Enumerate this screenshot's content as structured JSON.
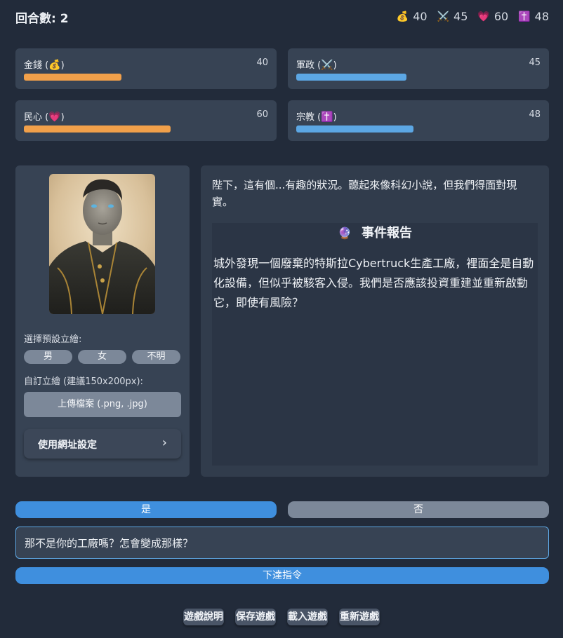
{
  "header": {
    "round_label": "回合數: 2",
    "stats": [
      {
        "icon": "money-bag-icon",
        "glyph": "💰",
        "value": "40"
      },
      {
        "icon": "crossed-swords-icon",
        "glyph": "⚔️",
        "value": "45"
      },
      {
        "icon": "heart-icon",
        "glyph": "💗",
        "value": "60"
      },
      {
        "icon": "latin-cross-icon",
        "glyph": "✝️",
        "value": "48"
      }
    ]
  },
  "stats": {
    "money": {
      "label_prefix": "金錢 (",
      "glyph": "💰",
      "label_suffix": ")",
      "value": "40",
      "level_percent": 40,
      "color": "#f1a04a"
    },
    "military": {
      "label_prefix": "軍政 (",
      "glyph": "⚔️",
      "label_suffix": ")",
      "value": "45",
      "level_percent": 45,
      "color": "#5ca7e4"
    },
    "people": {
      "label_prefix": "民心 (",
      "glyph": "💗",
      "label_suffix": ")",
      "value": "60",
      "level_percent": 60,
      "color": "#f1a04a"
    },
    "religion": {
      "label_prefix": "宗教 (",
      "glyph": "✝️",
      "label_suffix": ")",
      "value": "48",
      "level_percent": 48,
      "color": "#5ca7e4"
    }
  },
  "portrait_panel": {
    "preset_label": "選擇預設立繪:",
    "presets": [
      "男",
      "女",
      "不明"
    ],
    "custom_label": "自訂立繪 (建議150x200px):",
    "upload_label": "上傳檔案 (.png, .jpg)",
    "url_label": "使用網址設定",
    "url_chevron": "›"
  },
  "event": {
    "advisor_text": "陛下，這有個...有趣的狀況。聽起來像科幻小說，但我們得面對現實。",
    "report_glyph": "🔮",
    "report_title": "事件報告",
    "report_text": "城外發現一個廢棄的特斯拉Cybertruck生產工廠，裡面全是自動化設備，但似乎被駭客入侵。我們是否應該投資重建並重新啟動它，即使有風險？"
  },
  "choices": {
    "yes": "是",
    "no": "否"
  },
  "command": {
    "value": "那不是你的工廠嗎？怎會變成那樣？",
    "send_label": "下達指令"
  },
  "footer": [
    "遊戲說明",
    "保存遊戲",
    "載入遊戲",
    "重新遊戲"
  ],
  "colors": {
    "accent": "#3f8fde",
    "orange": "#f1a04a",
    "blue": "#5ca7e4",
    "background": "#222b3a"
  }
}
